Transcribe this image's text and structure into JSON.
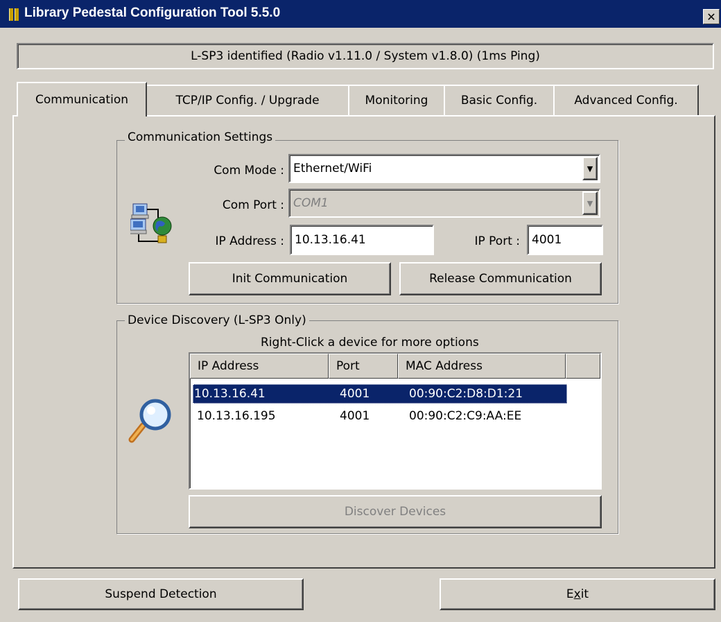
{
  "window": {
    "title": "Library Pedestal Configuration Tool 5.5.0",
    "close_label": "✕"
  },
  "status": "L-SP3 identified (Radio v1.11.0 / System v1.8.0) (1ms Ping)",
  "tabs": [
    {
      "label": "Communication",
      "active": true
    },
    {
      "label": "TCP/IP Config. / Upgrade",
      "active": false
    },
    {
      "label": "Monitoring",
      "active": false
    },
    {
      "label": "Basic Config.",
      "active": false
    },
    {
      "label": "Advanced Config.",
      "active": false
    }
  ],
  "communication_settings": {
    "legend": "Communication Settings",
    "com_mode_label": "Com Mode :",
    "com_mode_value": "Ethernet/WiFi",
    "com_port_label": "Com Port :",
    "com_port_value": "COM1",
    "ip_address_label": "IP Address :",
    "ip_address_value": "10.13.16.41",
    "ip_port_label": "IP Port :",
    "ip_port_value": "4001",
    "init_button": "Init Communication",
    "release_button": "Release Communication",
    "icon": "network-computers-icon"
  },
  "device_discovery": {
    "legend": "Device Discovery (L-SP3 Only)",
    "hint": "Right-Click a device for more options",
    "columns": [
      "IP Address",
      "Port",
      "MAC Address"
    ],
    "rows": [
      {
        "ip": "10.13.16.41",
        "port": "4001",
        "mac": "00:90:C2:D8:D1:21",
        "selected": true
      },
      {
        "ip": "10.13.16.195",
        "port": "4001",
        "mac": "00:90:C2:C9:AA:EE",
        "selected": false
      }
    ],
    "discover_button": "Discover Devices",
    "icon": "magnifier-icon"
  },
  "footer": {
    "suspend_button": "Suspend Detection",
    "exit_button_pre": "E",
    "exit_button_accel": "x",
    "exit_button_post": "it"
  },
  "colors": {
    "titlebar": "#0a246a",
    "face": "#d4d0c8",
    "selection": "#0a246a"
  }
}
